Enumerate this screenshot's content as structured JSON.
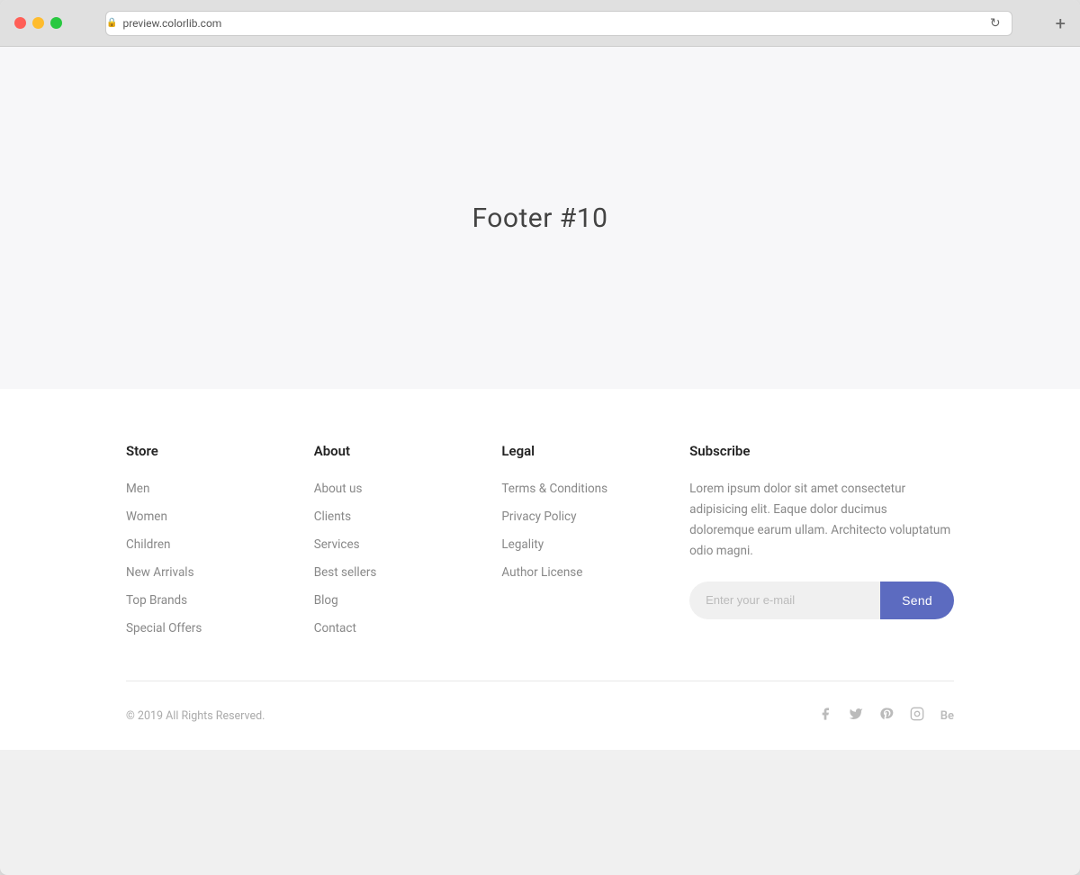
{
  "browser": {
    "url": "preview.colorlib.com",
    "new_tab_label": "+"
  },
  "hero": {
    "title": "Footer #10"
  },
  "footer": {
    "store": {
      "heading": "Store",
      "links": [
        {
          "label": "Men",
          "href": "#"
        },
        {
          "label": "Women",
          "href": "#"
        },
        {
          "label": "Children",
          "href": "#"
        },
        {
          "label": "New Arrivals",
          "href": "#"
        },
        {
          "label": "Top Brands",
          "href": "#"
        },
        {
          "label": "Special Offers",
          "href": "#"
        }
      ]
    },
    "about": {
      "heading": "About",
      "links": [
        {
          "label": "About us",
          "href": "#"
        },
        {
          "label": "Clients",
          "href": "#"
        },
        {
          "label": "Services",
          "href": "#"
        },
        {
          "label": "Best sellers",
          "href": "#"
        },
        {
          "label": "Blog",
          "href": "#"
        },
        {
          "label": "Contact",
          "href": "#"
        }
      ]
    },
    "legal": {
      "heading": "Legal",
      "links": [
        {
          "label": "Terms & Conditions",
          "href": "#"
        },
        {
          "label": "Privacy Policy",
          "href": "#"
        },
        {
          "label": "Legality",
          "href": "#"
        },
        {
          "label": "Author License",
          "href": "#"
        }
      ]
    },
    "subscribe": {
      "heading": "Subscribe",
      "description": "Lorem ipsum dolor sit amet consectetur adipisicing elit. Eaque dolor ducimus doloremque earum ullam. Architecto voluptatum odio magni.",
      "email_placeholder": "Enter your e-mail",
      "send_label": "Send"
    },
    "bottom": {
      "copyright": "© 2019 All Rights Reserved.",
      "social": [
        {
          "name": "facebook",
          "icon": "f"
        },
        {
          "name": "twitter",
          "icon": "t"
        },
        {
          "name": "pinterest",
          "icon": "p"
        },
        {
          "name": "instagram",
          "icon": "in"
        },
        {
          "name": "behance",
          "icon": "Be"
        }
      ]
    }
  }
}
